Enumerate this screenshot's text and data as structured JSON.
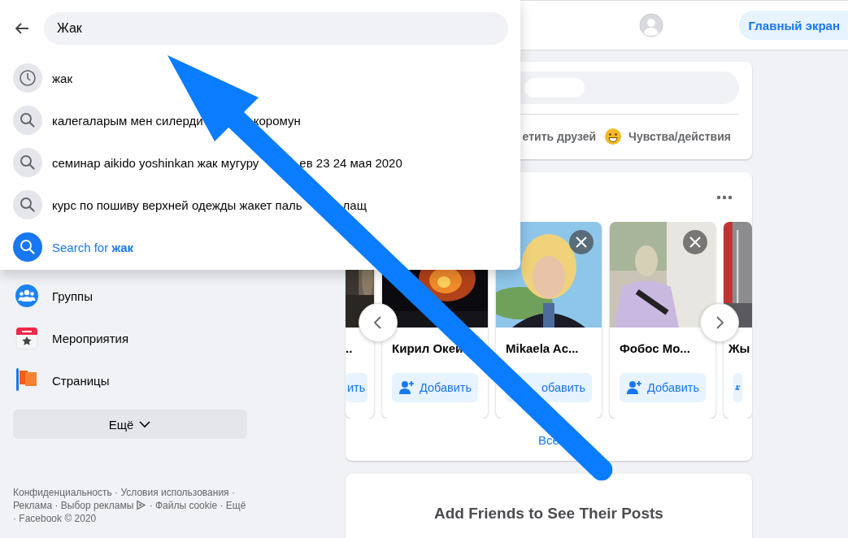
{
  "search_overlay": {
    "query": "Жак",
    "suggestions": [
      {
        "kind": "recent",
        "parts": [
          "жак"
        ]
      },
      {
        "kind": "search",
        "parts": [
          "калегаларым мен силерди",
          "коромун"
        ]
      },
      {
        "kind": "search",
        "parts": [
          "семинар aikido yoshinkan жак мугуру",
          "ев 23 24 мая 2020"
        ]
      },
      {
        "kind": "search",
        "parts": [
          "курс по пошиву верхней одежды жакет паль",
          "лащ"
        ]
      },
      {
        "kind": "search-for",
        "parts": [
          "Search for **жак**"
        ]
      }
    ]
  },
  "header": {
    "home_button": "Главный экран"
  },
  "sidebar": {
    "items": [
      {
        "kind": "groups",
        "label": "Группы"
      },
      {
        "kind": "events",
        "label": "Мероприятия"
      },
      {
        "kind": "pages",
        "label": "Страницы"
      }
    ],
    "more_button": "Ещё",
    "footer": {
      "separator": "·",
      "links": [
        {
          "text": "Конфиденциальность"
        },
        {
          "text": "Условия использования"
        },
        {
          "text": "Реклама"
        },
        {
          "text": "Выбор рекламы",
          "icon": true
        },
        {
          "text": "Файлы cookie"
        },
        {
          "text": "Ещё"
        },
        {
          "text": "Facebook © 2020"
        }
      ]
    }
  },
  "composer": {
    "actions": [
      {
        "kind": "tag",
        "label": "етить друзей"
      },
      {
        "kind": "feeling",
        "label": "Чувства/действия"
      }
    ]
  },
  "people_card": {
    "cards": [
      {
        "kind": "partial-left",
        "name": "..",
        "button": "ить",
        "button_icon": false
      },
      {
        "kind": "full",
        "name": "Кирил Окей",
        "button": "Добавить",
        "button_icon": true
      },
      {
        "kind": "full",
        "name": "Mikaela Ac...",
        "button": "обавить",
        "button_icon": false,
        "dismiss": true
      },
      {
        "kind": "full",
        "name": "Фобос Мо...",
        "button": "Добавить",
        "button_icon": true,
        "dismiss": true
      },
      {
        "kind": "partial-right",
        "name": "Жы",
        "button_icon": true,
        "dismiss": false
      }
    ],
    "see_all": "Все"
  },
  "empty_feed": {
    "title": "Add Friends to See Their Posts"
  }
}
